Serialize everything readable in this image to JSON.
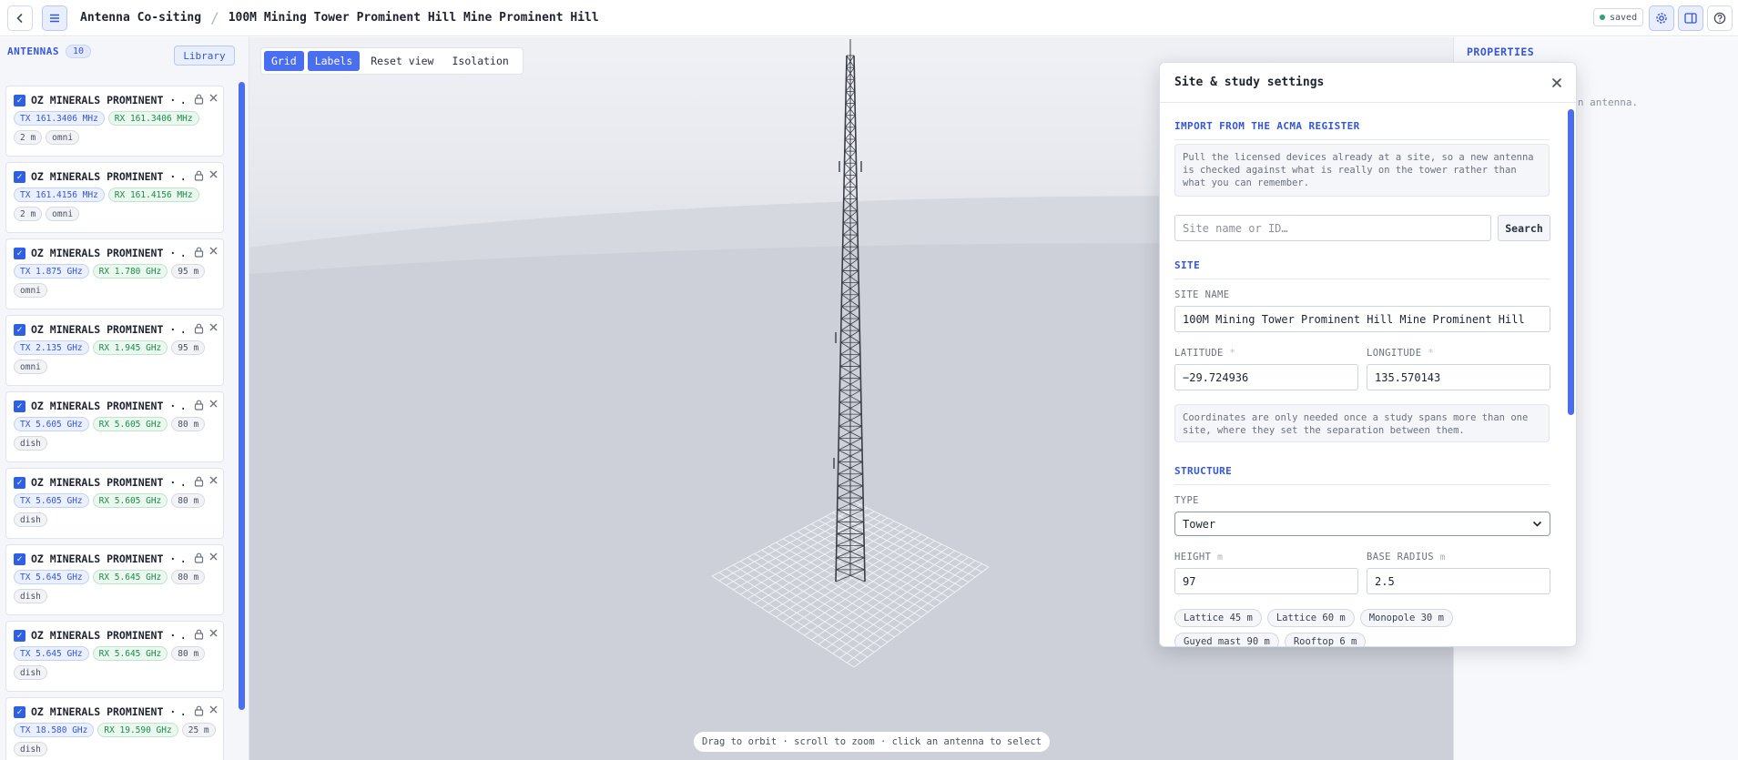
{
  "header": {
    "app_title": "Antenna Co-siting",
    "separator": "/",
    "doc_title": "100M Mining Tower Prominent Hill Mine Prominent Hill",
    "saved_label": "saved"
  },
  "antennas": {
    "title": "ANTENNAS",
    "count": "10",
    "library_label": "Library",
    "items": [
      {
        "name": "OZ MINERALS PROMINENT · …",
        "tags": [
          {
            "kind": "tx",
            "text": "TX 161.3406 MHz"
          },
          {
            "kind": "rx",
            "text": "RX 161.3406 MHz"
          },
          {
            "kind": "g",
            "text": "2 m"
          },
          {
            "kind": "g",
            "text": "omni"
          }
        ]
      },
      {
        "name": "OZ MINERALS PROMINENT · …",
        "tags": [
          {
            "kind": "tx",
            "text": "TX 161.4156 MHz"
          },
          {
            "kind": "rx",
            "text": "RX 161.4156 MHz"
          },
          {
            "kind": "g",
            "text": "2 m"
          },
          {
            "kind": "g",
            "text": "omni"
          }
        ]
      },
      {
        "name": "OZ MINERALS PROMINENT · …",
        "tags": [
          {
            "kind": "tx",
            "text": "TX 1.875 GHz"
          },
          {
            "kind": "rx",
            "text": "RX 1.780 GHz"
          },
          {
            "kind": "g",
            "text": "95 m"
          },
          {
            "kind": "g",
            "text": "omni"
          }
        ]
      },
      {
        "name": "OZ MINERALS PROMINENT · …",
        "tags": [
          {
            "kind": "tx",
            "text": "TX 2.135 GHz"
          },
          {
            "kind": "rx",
            "text": "RX 1.945 GHz"
          },
          {
            "kind": "g",
            "text": "95 m"
          },
          {
            "kind": "g",
            "text": "omni"
          }
        ]
      },
      {
        "name": "OZ MINERALS PROMINENT · …",
        "tags": [
          {
            "kind": "tx",
            "text": "TX 5.605 GHz"
          },
          {
            "kind": "rx",
            "text": "RX 5.605 GHz"
          },
          {
            "kind": "g",
            "text": "80 m"
          },
          {
            "kind": "g",
            "text": "dish"
          }
        ]
      },
      {
        "name": "OZ MINERALS PROMINENT · …",
        "tags": [
          {
            "kind": "tx",
            "text": "TX 5.605 GHz"
          },
          {
            "kind": "rx",
            "text": "RX 5.605 GHz"
          },
          {
            "kind": "g",
            "text": "80 m"
          },
          {
            "kind": "g",
            "text": "dish"
          }
        ]
      },
      {
        "name": "OZ MINERALS PROMINENT · …",
        "tags": [
          {
            "kind": "tx",
            "text": "TX 5.645 GHz"
          },
          {
            "kind": "rx",
            "text": "RX 5.645 GHz"
          },
          {
            "kind": "g",
            "text": "80 m"
          },
          {
            "kind": "g",
            "text": "dish"
          }
        ]
      },
      {
        "name": "OZ MINERALS PROMINENT · …",
        "tags": [
          {
            "kind": "tx",
            "text": "TX 5.645 GHz"
          },
          {
            "kind": "rx",
            "text": "RX 5.645 GHz"
          },
          {
            "kind": "g",
            "text": "80 m"
          },
          {
            "kind": "g",
            "text": "dish"
          }
        ]
      },
      {
        "name": "OZ MINERALS PROMINENT · …",
        "tags": [
          {
            "kind": "tx",
            "text": "TX 18.580 GHz"
          },
          {
            "kind": "rx",
            "text": "RX 19.590 GHz"
          },
          {
            "kind": "g",
            "text": "25 m"
          },
          {
            "kind": "g",
            "text": "dish"
          }
        ]
      }
    ]
  },
  "viewport": {
    "grid_label": "Grid",
    "labels_label": "Labels",
    "reset_label": "Reset view",
    "isolation_label": "Isolation",
    "hint": "Drag to orbit · scroll to zoom · click an antenna to select"
  },
  "properties": {
    "title": "PROPERTIES",
    "hint": "t an antenna."
  },
  "dialog": {
    "title": "Site & study settings",
    "import_section": "IMPORT FROM THE ACMA REGISTER",
    "import_note": "Pull the licensed devices already at a site, so a new antenna is checked against what is really on the tower rather than what you can remember.",
    "search_placeholder": "Site name or ID…",
    "search_label": "Search",
    "site_section": "SITE",
    "site_name_label": "SITE NAME",
    "site_name_value": "100M Mining Tower Prominent Hill Mine Prominent Hill",
    "latitude_label": "LATITUDE",
    "latitude_value": "−29.724936",
    "longitude_label": "LONGITUDE",
    "longitude_value": "135.570143",
    "required_mark": "*",
    "coords_note": "Coordinates are only needed once a study spans more than one site, where they set the separation between them.",
    "structure_section": "STRUCTURE",
    "type_label": "TYPE",
    "type_value": "Tower",
    "height_label": "HEIGHT",
    "height_unit": "m",
    "height_value": "97",
    "radius_label": "BASE RADIUS",
    "radius_unit": "m",
    "radius_value": "2.5",
    "presets": [
      "Lattice 45 m",
      "Lattice 60 m",
      "Monopole 30 m",
      "Guyed mast 90 m",
      "Rooftop 6 m"
    ]
  },
  "colors": {
    "accent": "#3556d8",
    "accent_fill": "#4a6ef0",
    "rx_green": "#1f8a4c",
    "saved_dot": "#2ea36b"
  }
}
